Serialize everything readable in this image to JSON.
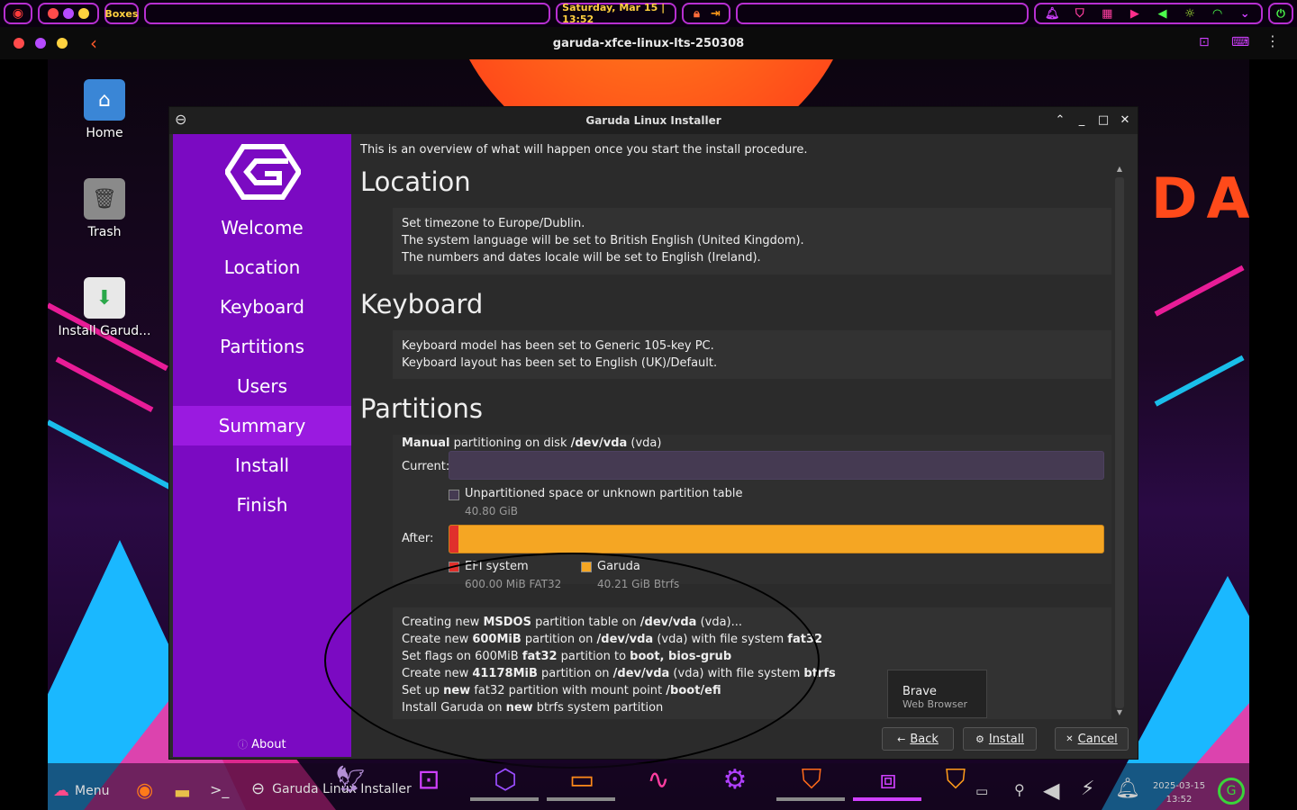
{
  "host_panel": {
    "app_label": "Boxes",
    "datetime": "Saturday, Mar 15 | 13:52"
  },
  "boxes": {
    "title": "garuda-xfce-linux-lts-250308"
  },
  "desktop": {
    "icons": [
      {
        "label": "Home"
      },
      {
        "label": "Trash"
      },
      {
        "label": "Install Garud..."
      }
    ],
    "banner_text": "DA"
  },
  "installer": {
    "title": "Garuda Linux Installer",
    "steps": [
      "Welcome",
      "Location",
      "Keyboard",
      "Partitions",
      "Users",
      "Summary",
      "Install",
      "Finish"
    ],
    "active_step": "Summary",
    "about_label": "About",
    "intro": "This is an overview of what will happen once you start the install procedure.",
    "location": {
      "heading": "Location",
      "lines": [
        "Set timezone to Europe/Dublin.",
        "The system language will be set to British English (United Kingdom).",
        "The numbers and dates locale will be set to English (Ireland)."
      ]
    },
    "keyboard": {
      "heading": "Keyboard",
      "lines": [
        "Keyboard model has been set to Generic 105-key PC.",
        "Keyboard layout has been set to English (UK)/Default."
      ]
    },
    "partitions": {
      "heading": "Partitions",
      "mode_bold": "Manual",
      "mode_text": " partitioning on disk ",
      "disk_bold": "/dev/vda",
      "disk_suffix": " (vda)",
      "current_label": "Current:",
      "after_label": "After:",
      "current_legend": {
        "name": "Unpartitioned space or unknown partition table",
        "sub": "40.80 GiB"
      },
      "after_legend": [
        {
          "name": "EFI system",
          "sub": "600.00 MiB  FAT32",
          "color": "#e0302c"
        },
        {
          "name": "Garuda",
          "sub": "40.21 GiB  Btrfs",
          "color": "#f5a623"
        }
      ],
      "efi_fraction": 0.014,
      "ops": {
        "l1a": "Creating new ",
        "l1b": "MSDOS",
        "l1c": " partition table on ",
        "l1d": "/dev/vda",
        "l1e": " (vda)...",
        "l2a": "Create new ",
        "l2b": "600MiB",
        "l2c": " partition on ",
        "l2d": "/dev/vda",
        "l2e": " (vda) with file system ",
        "l2f": "fat32",
        "l3a": "Set flags on 600MiB ",
        "l3b": "fat32",
        "l3c": " partition to ",
        "l3d": "boot, bios-grub",
        "l4a": "Create new ",
        "l4b": "41178MiB",
        "l4c": " partition on ",
        "l4d": "/dev/vda",
        "l4e": " (vda) with file system ",
        "l4f": "btrfs",
        "l5a": "Set up ",
        "l5b": "new",
        "l5c": " fat32 partition with mount point ",
        "l5d": "/boot/efi",
        "l6a": "Install Garuda on ",
        "l6b": "new",
        "l6c": " btrfs system partition"
      }
    },
    "buttons": {
      "back": "Back",
      "install": "Install",
      "cancel": "Cancel"
    }
  },
  "tooltip": {
    "title": "Brave",
    "subtitle": "Web Browser"
  },
  "guest_panel": {
    "menu_label": "Menu",
    "task_label": "Garuda Linux Installer",
    "date": "2025-03-15",
    "time": "13:52"
  },
  "colors": {
    "accent_purple": "#7b0ac2",
    "active_step": "#9a1ae0",
    "host_border": "#b72fd1",
    "efi": "#e0302c",
    "garuda": "#f5a623"
  }
}
